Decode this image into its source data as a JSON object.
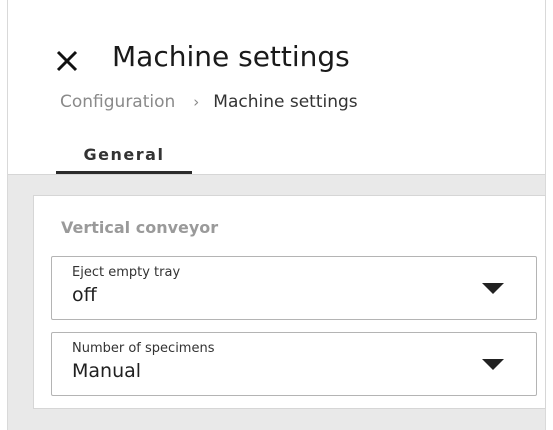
{
  "header": {
    "title": "Machine settings",
    "close_icon": "close-icon"
  },
  "breadcrumb": {
    "items": [
      "Configuration",
      "Machine settings"
    ],
    "separator": "›"
  },
  "tabs": [
    {
      "label": "General",
      "active": true
    }
  ],
  "section": {
    "title": "Vertical conveyor",
    "fields": [
      {
        "label": "Eject empty tray",
        "value": "off"
      },
      {
        "label": "Number of specimens",
        "value": "Manual"
      }
    ]
  },
  "colors": {
    "background": "#e9e9e9",
    "text": "#1a1a1a",
    "muted": "#8a8a8a",
    "tab_indicator": "#2b2b2b"
  }
}
